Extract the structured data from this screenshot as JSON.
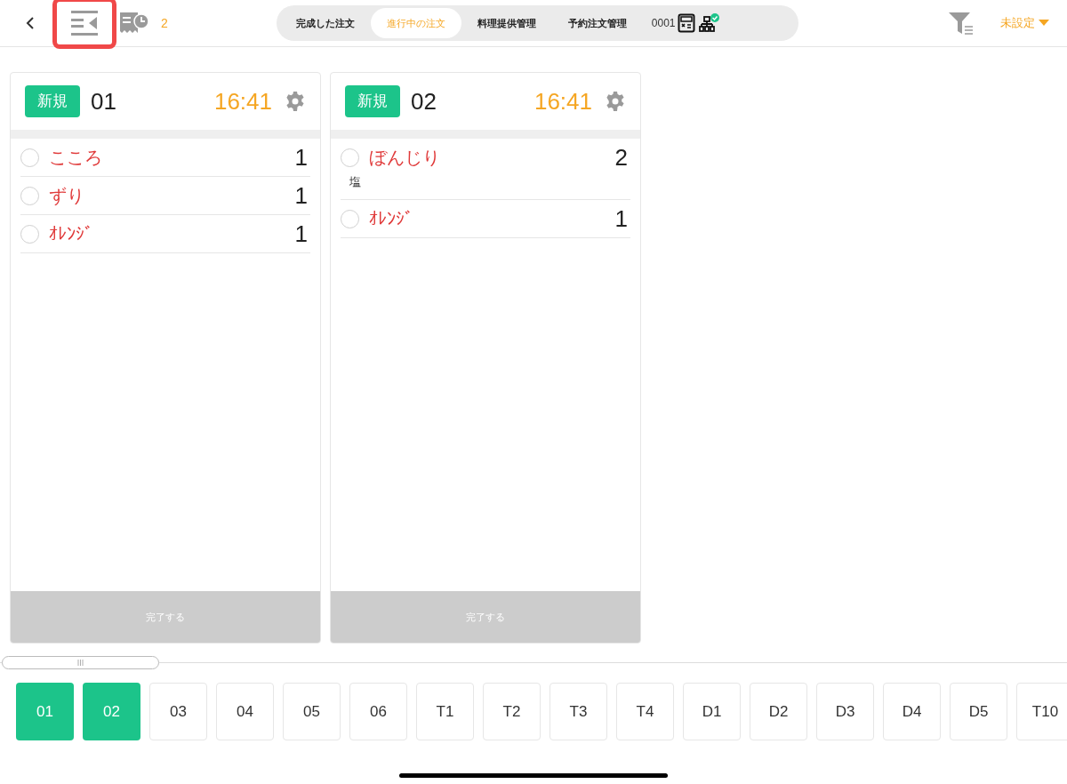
{
  "header": {
    "order_icon_highlighted": true,
    "pending_count": "2",
    "tabs": [
      {
        "label": "完成した注文",
        "selected": false
      },
      {
        "label": "進行中の注文",
        "selected": true
      },
      {
        "label": "料理提供管理",
        "selected": false
      },
      {
        "label": "予約注文管理",
        "selected": false
      }
    ],
    "terminal_id": "0001",
    "printer_connected": true,
    "setting_dropdown": "未設定"
  },
  "orders": [
    {
      "status": "新規",
      "table": "01",
      "time": "16:41",
      "complete_button": "完了する",
      "items": [
        {
          "name": "こころ",
          "quantity": "1",
          "checked": false
        },
        {
          "name": "ずり",
          "quantity": "1",
          "checked": false
        },
        {
          "name": "ｵﾚﾝｼﾞ",
          "quantity": "1",
          "checked": false
        }
      ]
    },
    {
      "status": "新規",
      "table": "02",
      "time": "16:41",
      "complete_button": "完了する",
      "items": [
        {
          "name": "ぼんじり",
          "quantity": "2",
          "note": "塩",
          "checked": false
        },
        {
          "name": "ｵﾚﾝｼﾞ",
          "quantity": "1",
          "checked": false
        }
      ]
    }
  ],
  "table_tabs": [
    {
      "label": "01",
      "selected": true
    },
    {
      "label": "02",
      "selected": true
    },
    {
      "label": "03",
      "selected": false
    },
    {
      "label": "04",
      "selected": false
    },
    {
      "label": "05",
      "selected": false
    },
    {
      "label": "06",
      "selected": false
    },
    {
      "label": "T1",
      "selected": false
    },
    {
      "label": "T2",
      "selected": false
    },
    {
      "label": "T3",
      "selected": false
    },
    {
      "label": "T4",
      "selected": false
    },
    {
      "label": "D1",
      "selected": false
    },
    {
      "label": "D2",
      "selected": false
    },
    {
      "label": "D3",
      "selected": false
    },
    {
      "label": "D4",
      "selected": false
    },
    {
      "label": "D5",
      "selected": false
    },
    {
      "label": "T10",
      "selected": false
    }
  ]
}
